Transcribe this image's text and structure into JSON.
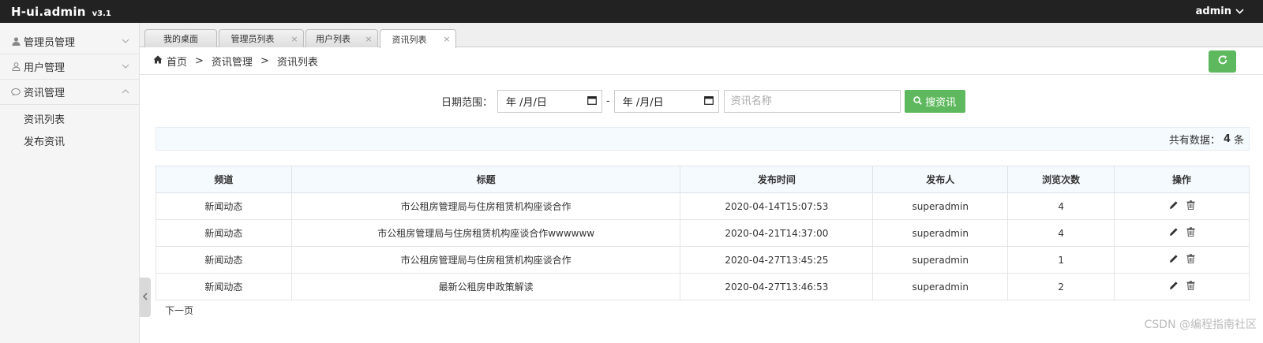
{
  "app": {
    "name": "H-ui.admin",
    "version": "v3.1",
    "user": "admin"
  },
  "sidebar": {
    "items": [
      {
        "label": "管理员管理",
        "icon": "user-icon"
      },
      {
        "label": "用户管理",
        "icon": "user-outline-icon"
      },
      {
        "label": "资讯管理",
        "icon": "comment-icon",
        "expanded": true
      }
    ],
    "submenu": [
      "资讯列表",
      "发布资讯"
    ]
  },
  "tabs": [
    {
      "label": "我的桌面",
      "closable": false
    },
    {
      "label": "管理员列表",
      "closable": true
    },
    {
      "label": "用户列表",
      "closable": true
    },
    {
      "label": "资讯列表",
      "closable": true,
      "active": true
    }
  ],
  "breadcrumb": [
    "首页",
    "资讯管理",
    "资讯列表"
  ],
  "filter": {
    "date_label": "日期范围：",
    "date_placeholder": "年 /月/日",
    "dash": "-",
    "name_placeholder": "资讯名称",
    "search_label": "搜资讯"
  },
  "count": {
    "prefix": "共有数据：",
    "value": "4",
    "suffix": "条"
  },
  "table": {
    "headers": [
      "频道",
      "标题",
      "发布时间",
      "发布人",
      "浏览次数",
      "操作"
    ],
    "rows": [
      [
        "新闻动态",
        "市公租房管理局与住房租赁机构座谈合作",
        "2020-04-14T15:07:53",
        "superadmin",
        "4"
      ],
      [
        "新闻动态",
        "市公租房管理局与住房租赁机构座谈合作wwwwww",
        "2020-04-21T14:37:00",
        "superadmin",
        "4"
      ],
      [
        "新闻动态",
        "市公租房管理局与住房租赁机构座谈合作",
        "2020-04-27T13:45:25",
        "superadmin",
        "1"
      ],
      [
        "新闻动态",
        "最新公租房申政策解读",
        "2020-04-27T13:46:53",
        "superadmin",
        "2"
      ]
    ]
  },
  "pagination": {
    "next": "下一页"
  },
  "watermark": "CSDN @编程指南社区",
  "colors": {
    "topbar": "#222222",
    "accent": "#5eb95e",
    "sidebar": "#f5f5f5"
  }
}
